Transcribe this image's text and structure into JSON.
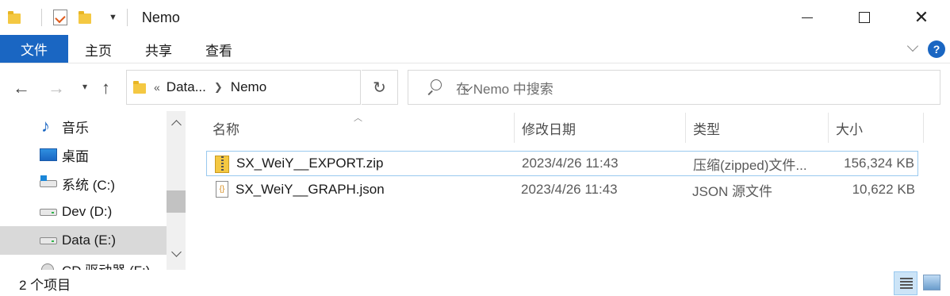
{
  "window": {
    "title": "Nemo"
  },
  "ribbon": {
    "tabs": [
      "文件",
      "主页",
      "共享",
      "查看"
    ],
    "help_label": "?"
  },
  "address": {
    "overflow": "«",
    "crumbs": [
      "Data...",
      "Nemo"
    ],
    "search_placeholder": "在 Nemo 中搜索"
  },
  "nav_pane": {
    "items": [
      {
        "label": "音乐",
        "icon": "music-icon"
      },
      {
        "label": "桌面",
        "icon": "desktop-icon"
      },
      {
        "label": "系统 (C:)",
        "icon": "system-drive-icon"
      },
      {
        "label": "Dev (D:)",
        "icon": "drive-icon"
      },
      {
        "label": "Data (E:)",
        "icon": "drive-icon",
        "selected": true
      },
      {
        "label": "CD 驱动器 (F:)",
        "icon": "cd-drive-icon"
      }
    ]
  },
  "file_list": {
    "columns": [
      "名称",
      "修改日期",
      "类型",
      "大小"
    ],
    "rows": [
      {
        "name": "SX_WeiY__EXPORT.zip",
        "date": "2023/4/26 11:43",
        "type": "压缩(zipped)文件...",
        "size": "156,324 KB",
        "icon": "zip-icon"
      },
      {
        "name": "SX_WeiY__GRAPH.json",
        "date": "2023/4/26 11:43",
        "type": "JSON 源文件",
        "size": "10,622 KB",
        "icon": "json-file-icon"
      }
    ]
  },
  "status_bar": {
    "item_count": "2 个项目"
  },
  "colors": {
    "accent": "#1a66c2",
    "selection_border": "#99c9ef",
    "nav_selected": "#d9d9d9"
  }
}
